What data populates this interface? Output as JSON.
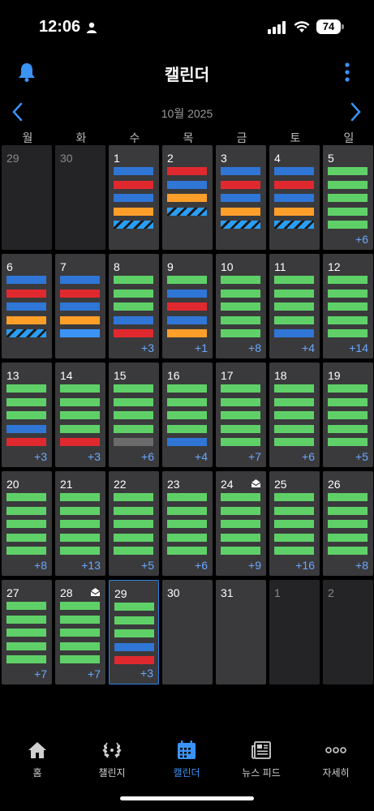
{
  "status_bar": {
    "time": "12:06",
    "battery": "74",
    "icons": [
      "person-icon",
      "signal-icon",
      "wifi-icon",
      "battery-icon"
    ]
  },
  "header": {
    "title": "캘린더",
    "left_icon": "bell-icon",
    "right_icon": "more-vertical-icon",
    "accent": "#3b93f5"
  },
  "month_nav": {
    "label": "10월 2025",
    "prev_icon": "chevron-left-icon",
    "next_icon": "chevron-right-icon"
  },
  "weekdays": [
    "월",
    "화",
    "수",
    "목",
    "금",
    "토",
    "일"
  ],
  "colors": {
    "green": "#5fd068",
    "blue": "#2f76d6",
    "lightblue": "#3b93f5",
    "red": "#e0292f",
    "orange": "#ff9f2a",
    "gray": "#6b6b6b",
    "stripe": "#2a9df4",
    "more_count": "#6aa8ff",
    "cell": "#3a3a3c",
    "cell_other": "#242426"
  },
  "weeks": [
    [
      {
        "day": "29",
        "other": true,
        "bars": [],
        "more": ""
      },
      {
        "day": "30",
        "other": true,
        "bars": [],
        "more": ""
      },
      {
        "day": "1",
        "bars": [
          "blue",
          "red",
          "blue",
          "orange",
          "stripe"
        ],
        "more": ""
      },
      {
        "day": "2",
        "bars": [
          "red",
          "blue",
          "orange",
          "stripe"
        ],
        "more": ""
      },
      {
        "day": "3",
        "bars": [
          "blue",
          "red",
          "blue",
          "orange",
          "stripe"
        ],
        "more": ""
      },
      {
        "day": "4",
        "bars": [
          "blue",
          "red",
          "blue",
          "orange",
          "stripe"
        ],
        "more": ""
      },
      {
        "day": "5",
        "bars": [
          "green",
          "green",
          "green",
          "green",
          "green"
        ],
        "more": "+6"
      }
    ],
    [
      {
        "day": "6",
        "bars": [
          "blue",
          "red",
          "blue",
          "orange",
          "stripe"
        ],
        "more": ""
      },
      {
        "day": "7",
        "bars": [
          "blue",
          "red",
          "blue",
          "orange",
          "lightblue"
        ],
        "more": ""
      },
      {
        "day": "8",
        "bars": [
          "green",
          "green",
          "green",
          "blue",
          "red"
        ],
        "more": "+3"
      },
      {
        "day": "9",
        "bars": [
          "green",
          "blue",
          "red",
          "blue",
          "orange"
        ],
        "more": "+1"
      },
      {
        "day": "10",
        "bars": [
          "green",
          "green",
          "green",
          "green",
          "green"
        ],
        "more": "+8"
      },
      {
        "day": "11",
        "bars": [
          "green",
          "green",
          "green",
          "green",
          "blue"
        ],
        "more": "+4"
      },
      {
        "day": "12",
        "bars": [
          "green",
          "green",
          "green",
          "green",
          "green"
        ],
        "more": "+14"
      }
    ],
    [
      {
        "day": "13",
        "bars": [
          "green",
          "green",
          "green",
          "blue",
          "red"
        ],
        "more": "+3"
      },
      {
        "day": "14",
        "bars": [
          "green",
          "green",
          "green",
          "green",
          "red"
        ],
        "more": "+3"
      },
      {
        "day": "15",
        "bars": [
          "green",
          "green",
          "green",
          "green",
          "gray"
        ],
        "more": "+6"
      },
      {
        "day": "16",
        "bars": [
          "green",
          "green",
          "green",
          "green",
          "blue"
        ],
        "more": "+4"
      },
      {
        "day": "17",
        "bars": [
          "green",
          "green",
          "green",
          "green",
          "green"
        ],
        "more": "+7"
      },
      {
        "day": "18",
        "bars": [
          "green",
          "green",
          "green",
          "green",
          "green"
        ],
        "more": "+6"
      },
      {
        "day": "19",
        "bars": [
          "green",
          "green",
          "green",
          "green",
          "green"
        ],
        "more": "+5"
      }
    ],
    [
      {
        "day": "20",
        "bars": [
          "green",
          "green",
          "green",
          "green",
          "green"
        ],
        "more": "+8"
      },
      {
        "day": "21",
        "bars": [
          "green",
          "green",
          "green",
          "green",
          "green"
        ],
        "more": "+13"
      },
      {
        "day": "22",
        "bars": [
          "green",
          "green",
          "green",
          "green",
          "green"
        ],
        "more": "+5"
      },
      {
        "day": "23",
        "bars": [
          "green",
          "green",
          "green",
          "green",
          "green"
        ],
        "more": "+6"
      },
      {
        "day": "24",
        "mail": true,
        "bars": [
          "green",
          "green",
          "green",
          "green",
          "green"
        ],
        "more": "+9"
      },
      {
        "day": "25",
        "bars": [
          "green",
          "green",
          "green",
          "green",
          "green"
        ],
        "more": "+16"
      },
      {
        "day": "26",
        "bars": [
          "green",
          "green",
          "green",
          "green",
          "green"
        ],
        "more": "+8"
      }
    ],
    [
      {
        "day": "27",
        "bars": [
          "green",
          "green",
          "green",
          "green",
          "green"
        ],
        "more": "+7"
      },
      {
        "day": "28",
        "mail": true,
        "bars": [
          "green",
          "green",
          "green",
          "green",
          "green"
        ],
        "more": "+7"
      },
      {
        "day": "29",
        "today": true,
        "bars": [
          "green",
          "green",
          "green",
          "blue",
          "red"
        ],
        "more": "+3"
      },
      {
        "day": "30",
        "bars": [],
        "more": ""
      },
      {
        "day": "31",
        "bars": [],
        "more": ""
      },
      {
        "day": "1",
        "other": true,
        "bars": [],
        "more": ""
      },
      {
        "day": "2",
        "other": true,
        "bars": [],
        "more": ""
      }
    ]
  ],
  "tabs": [
    {
      "label": "홈",
      "icon": "home-icon",
      "active": false
    },
    {
      "label": "챌린지",
      "icon": "laurel-icon",
      "active": false
    },
    {
      "label": "캘린더",
      "icon": "calendar-icon",
      "active": true
    },
    {
      "label": "뉴스 피드",
      "icon": "newspaper-icon",
      "active": false
    },
    {
      "label": "자세히",
      "icon": "more-horizontal-icon",
      "active": false
    }
  ]
}
